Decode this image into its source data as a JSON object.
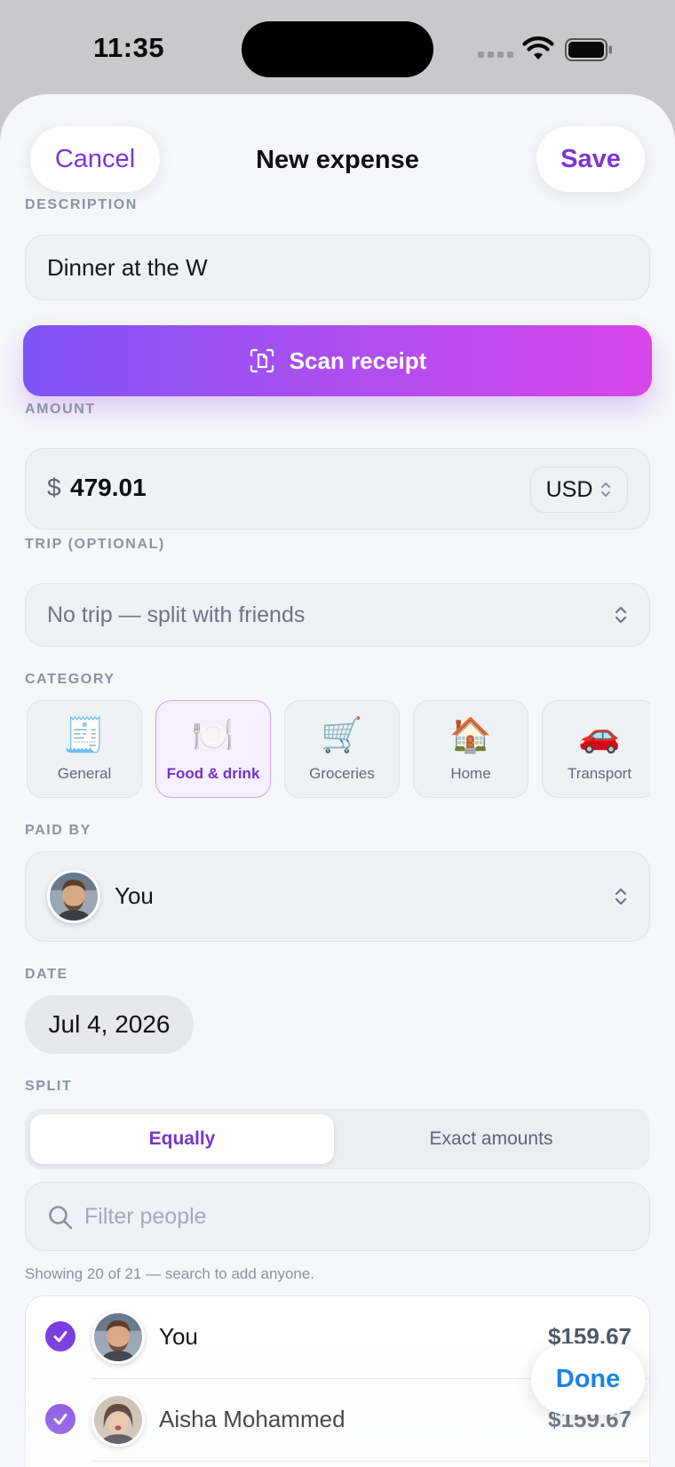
{
  "status_bar": {
    "time": "11:35"
  },
  "nav": {
    "cancel_label": "Cancel",
    "title": "New expense",
    "save_label": "Save"
  },
  "description": {
    "label": "DESCRIPTION",
    "value": "Dinner at the W"
  },
  "scan": {
    "label": "Scan receipt"
  },
  "amount": {
    "label": "AMOUNT",
    "symbol": "$",
    "value": "479.01",
    "currency": "USD"
  },
  "trip": {
    "label": "TRIP (OPTIONAL)",
    "value": "No trip — split with friends"
  },
  "category": {
    "label": "CATEGORY",
    "items": [
      {
        "emoji": "🧾",
        "label": "General",
        "selected": false
      },
      {
        "emoji": "🍽️",
        "label": "Food & drink",
        "selected": true
      },
      {
        "emoji": "🛒",
        "label": "Groceries",
        "selected": false
      },
      {
        "emoji": "🏠",
        "label": "Home",
        "selected": false
      },
      {
        "emoji": "🚗",
        "label": "Transport",
        "selected": false
      }
    ]
  },
  "paid_by": {
    "label": "PAID BY",
    "name": "You"
  },
  "date": {
    "label": "DATE",
    "value": "Jul 4, 2026"
  },
  "split": {
    "label": "SPLIT",
    "options": [
      "Equally",
      "Exact amounts"
    ],
    "selected": "Equally",
    "filter_placeholder": "Filter people",
    "showing_text": "Showing 20 of 21 — search to add anyone.",
    "people": [
      {
        "name": "You",
        "amount": "$159.67",
        "checked": true
      },
      {
        "name": "Aisha Mohammed",
        "amount": "$159.67",
        "checked": true
      }
    ]
  },
  "done_label": "Done",
  "colors": {
    "accent": "#7a35d8",
    "done_blue": "#1d82e8",
    "gradient_start": "#8054f7",
    "gradient_end": "#d947ec"
  }
}
